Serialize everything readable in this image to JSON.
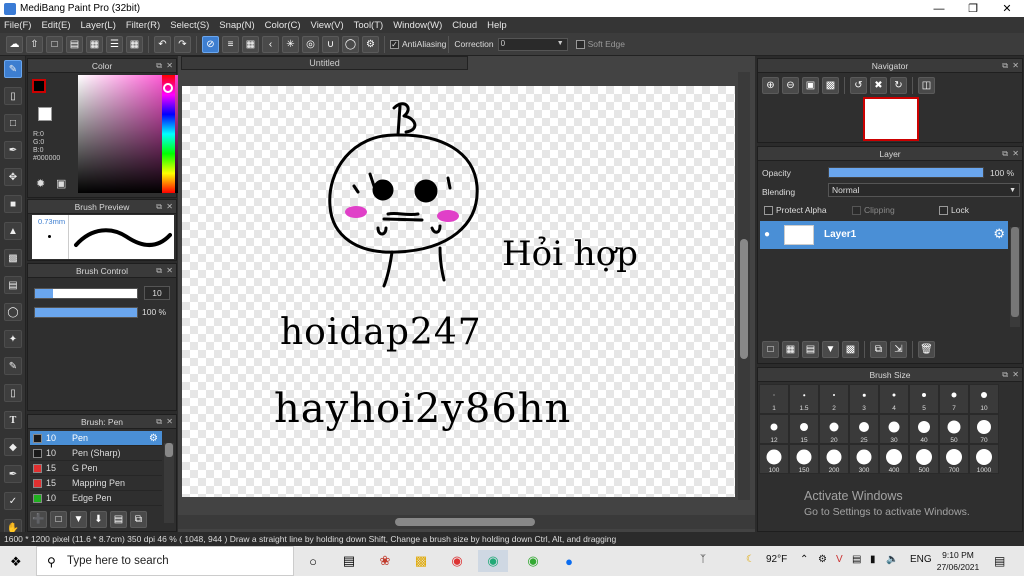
{
  "window": {
    "title": "MediBang Paint Pro (32bit)"
  },
  "menu": [
    "File(F)",
    "Edit(E)",
    "Layer(L)",
    "Filter(R)",
    "Select(S)",
    "Snap(N)",
    "Color(C)",
    "View(V)",
    "Tool(T)",
    "Window(W)",
    "Cloud",
    "Help"
  ],
  "toolbar": {
    "antialiasing_label": "AntiAliasing",
    "antialiasing_checked": true,
    "correction_label": "Correction",
    "correction_value": "0",
    "soft_edge_label": "Soft Edge",
    "soft_edge_checked": false
  },
  "color_panel": {
    "title": "Color",
    "r": "R:0",
    "g": "G:0",
    "b": "B:0",
    "hex": "#000000",
    "foreground": "#000000",
    "background": "#ffffff"
  },
  "brush_preview": {
    "title": "Brush Preview",
    "size": "0.73mm"
  },
  "brush_control": {
    "title": "Brush Control",
    "size_value": "10",
    "opacity_value": "100 %",
    "opacity": 1.0
  },
  "brush_list": {
    "title": "Brush: Pen",
    "items": [
      {
        "size": "10",
        "name": "Pen",
        "color": "#1a1a1a",
        "selected": true
      },
      {
        "size": "10",
        "name": "Pen (Sharp)",
        "color": "#1a1a1a",
        "selected": false
      },
      {
        "size": "15",
        "name": "G Pen",
        "color": "#e03030",
        "selected": false
      },
      {
        "size": "15",
        "name": "Mapping Pen",
        "color": "#e03030",
        "selected": false
      },
      {
        "size": "10",
        "name": "Edge Pen",
        "color": "#20b020",
        "selected": false
      }
    ]
  },
  "canvas": {
    "tab": "Untitled"
  },
  "navigator": {
    "title": "Navigator"
  },
  "layer_panel": {
    "title": "Layer",
    "opacity_label": "Opacity",
    "opacity_value": "100 %",
    "opacity": 1.0,
    "blending_label": "Blending",
    "blending_value": "Normal",
    "protect_alpha": "Protect Alpha",
    "clipping": "Clipping",
    "lock": "Lock",
    "layers": [
      {
        "name": "Layer1"
      }
    ]
  },
  "brush_size": {
    "title": "Brush Size",
    "sizes": [
      "1",
      "1.5",
      "2",
      "3",
      "4",
      "5",
      "7",
      "10",
      "12",
      "15",
      "20",
      "25",
      "30",
      "40",
      "50",
      "70",
      "100",
      "150",
      "200",
      "300",
      "400",
      "500",
      "700",
      "1000"
    ]
  },
  "status": {
    "text": "1600 * 1200 pixel   (11.6 * 8.7cm)   350 dpi   46 %   ( 1048, 944 )   Draw a straight line by holding down Shift, Change a brush size by holding down Ctrl, Alt, and dragging"
  },
  "watermark": {
    "line1": "Activate Windows",
    "line2": "Go to Settings to activate Windows."
  },
  "taskbar": {
    "search_placeholder": "Type here to search",
    "weather": "92°F",
    "language": "ENG",
    "time": "9:10 PM",
    "date": "27/06/2021"
  },
  "drawing_text": {
    "line1": "Hỏi hợp",
    "line2": "hoidap247",
    "line3": "hayhoi2y86hn"
  }
}
